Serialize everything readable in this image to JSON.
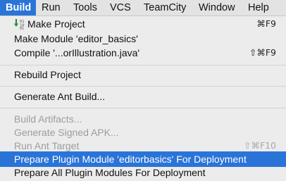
{
  "menubar": {
    "items": [
      "Build",
      "Run",
      "Tools",
      "VCS",
      "TeamCity",
      "Window",
      "Help"
    ]
  },
  "menu": {
    "make_project": {
      "label": "Make Project",
      "shortcut": "⌘F9"
    },
    "make_module": {
      "label": "Make Module 'editor_basics'"
    },
    "compile": {
      "label": "Compile '...orIllustration.java'",
      "shortcut": "⇧⌘F9"
    },
    "rebuild": {
      "label": "Rebuild Project"
    },
    "generate_ant": {
      "label": "Generate Ant Build..."
    },
    "build_artifacts": {
      "label": "Build Artifacts..."
    },
    "generate_apk": {
      "label": "Generate Signed APK..."
    },
    "run_ant": {
      "label": "Run Ant Target",
      "shortcut": "⇧⌘F10"
    },
    "prepare_plugin": {
      "label": "Prepare Plugin Module 'editorbasics' For Deployment"
    },
    "prepare_all": {
      "label": "Prepare All Plugin Modules For Deployment"
    }
  },
  "colors": {
    "highlight": "#2a74d8",
    "menu_bg": "#ececec",
    "disabled": "#9d9d9d"
  },
  "icons": {
    "make_project": "make-project-icon"
  }
}
